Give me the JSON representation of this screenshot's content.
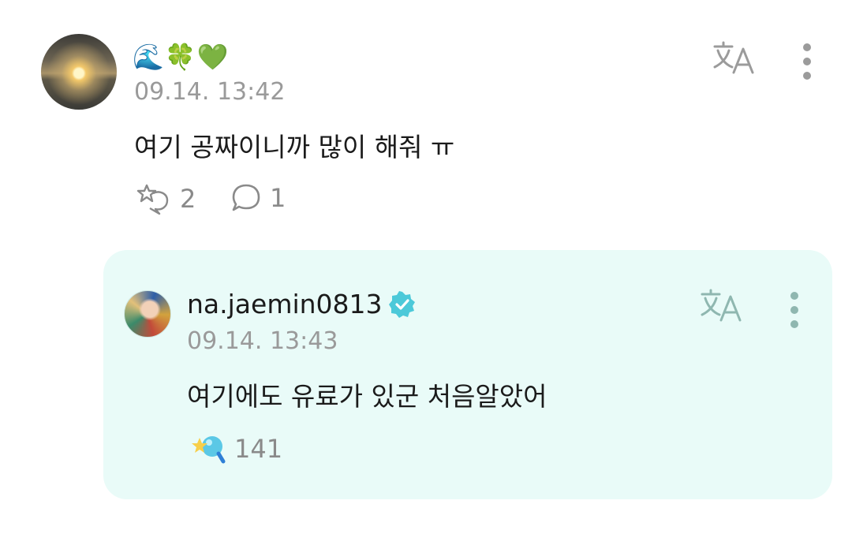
{
  "comment": {
    "username": "🌊🍀💚",
    "timestamp": "09.14. 13:42",
    "text": "여기 공짜이니까 많이 해줘 ㅠ",
    "reaction_count": "2",
    "reply_count": "1",
    "avatar": "sunset-photo"
  },
  "reply": {
    "username": "na.jaemin0813",
    "verified": true,
    "timestamp": "09.14. 13:43",
    "text": "여기에도 유료가 있군 처음알았어",
    "cheer_count": "141",
    "avatar": "artist-photo"
  },
  "icons": {
    "translate": "translate-icon",
    "more": "more-vertical-icon",
    "react": "reaction-icon",
    "reply": "reply-bubble-icon",
    "cheer": "cheer-icon",
    "verified": "verified-badge-icon"
  },
  "colors": {
    "reply_card_bg": "#e9fbf8",
    "verified": "#4cc9d9",
    "muted_text": "#9a9a9a"
  }
}
